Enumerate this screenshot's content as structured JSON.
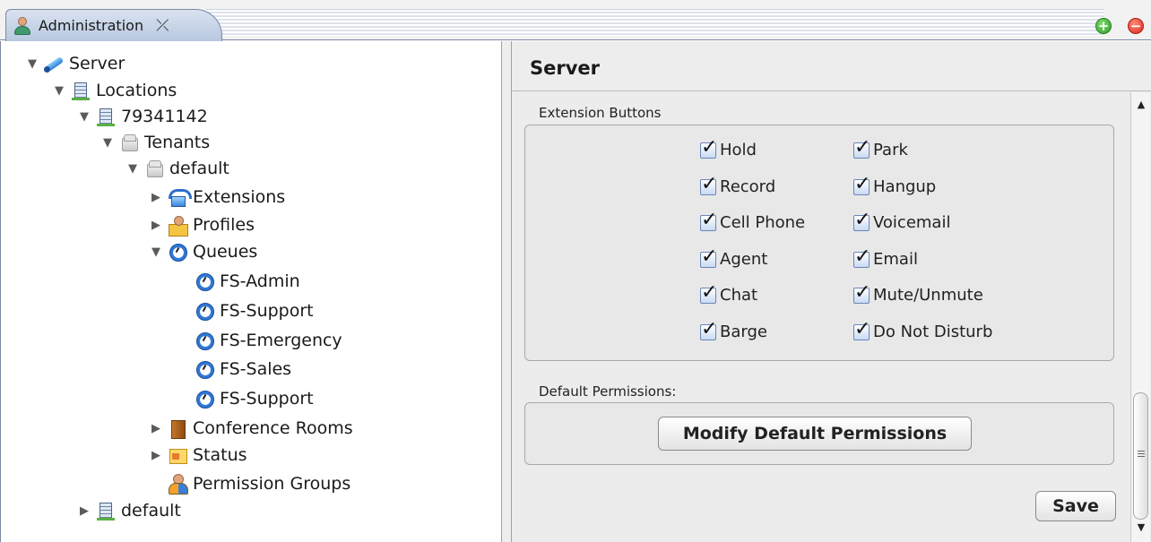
{
  "tab": {
    "title": "Administration",
    "close_glyph": "⤫"
  },
  "window_buttons": {
    "add_glyph": "+",
    "remove_glyph": "−"
  },
  "tree": {
    "server": "Server",
    "locations": "Locations",
    "location_id": "79341142",
    "tenants": "Tenants",
    "tenant_default": "default",
    "extensions": "Extensions",
    "profiles": "Profiles",
    "queues": "Queues",
    "queue_items": [
      "FS-Admin",
      "FS-Support",
      "FS-Emergency",
      "FS-Sales",
      "FS-Support"
    ],
    "conference_rooms": "Conference Rooms",
    "status": "Status",
    "permission_groups": "Permission Groups",
    "location_default": "default"
  },
  "panel": {
    "title": "Server",
    "extension_buttons_label": "Extension Buttons",
    "checkboxes_left": [
      {
        "label": "Hold",
        "checked": true
      },
      {
        "label": "Record",
        "checked": true
      },
      {
        "label": "Cell Phone",
        "checked": true
      },
      {
        "label": "Agent",
        "checked": true
      },
      {
        "label": "Chat",
        "checked": true
      },
      {
        "label": "Barge",
        "checked": true
      }
    ],
    "checkboxes_right": [
      {
        "label": "Park",
        "checked": true
      },
      {
        "label": "Hangup",
        "checked": true
      },
      {
        "label": "Voicemail",
        "checked": true
      },
      {
        "label": "Email",
        "checked": true
      },
      {
        "label": "Mute/Unmute",
        "checked": true
      },
      {
        "label": "Do Not Disturb",
        "checked": true
      }
    ],
    "default_permissions_label": "Default Permissions:",
    "modify_button": "Modify Default Permissions",
    "save_button": "Save"
  },
  "colors": {
    "tab_accent": "#b8c8e0",
    "checkbox_fill": "#c9daf2",
    "add_button": "#2f9e2a",
    "remove_button": "#d92a1c"
  }
}
